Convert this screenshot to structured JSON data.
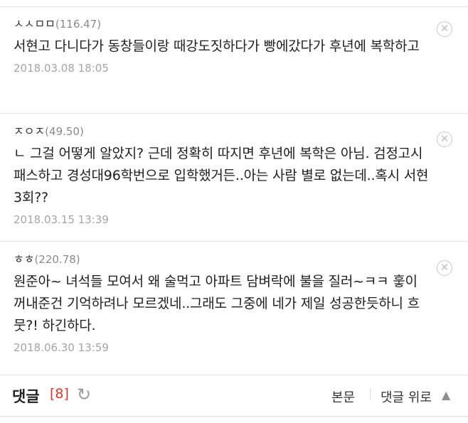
{
  "comments": [
    {
      "author": "ㅅㅅㅁㅁ",
      "score": "(116.47)",
      "text": "서현고 다니다가 동창들이랑 때강도짓하다가 빵에갔다가 후년에 복학하고",
      "date": "2018.03.08 18:05",
      "close_icon": "✕"
    },
    {
      "author": "ㅈㅇㅈ",
      "score": "(49.50)",
      "text": "ㄴ 그걸 어떻게 알았지? 근데 정확히 따지면 후년에 복학은 아님. 검정고시 패스하고 경성대96학번으로 입학했거든..아는 사람 별로 없는데..혹시 서현 3회??",
      "date": "2018.03.15 13:39",
      "close_icon": "✕"
    },
    {
      "author": "ㅎㅎ",
      "score": "(220.78)",
      "text": "원준아~ 녀석들 모여서 왜 술먹고 아파트 담벼락에 불을 질러~ㅋㅋ 훟이 꺼내준건 기억하려나 모르겠네..그래도 그중에 네가 제일 성공한듯하니 흐뭇?! 하긴하다.",
      "date": "2018.06.30 13:59",
      "close_icon": "✕"
    }
  ],
  "footer": {
    "title": "댓글",
    "count": "[8]",
    "refresh_icon": "↻",
    "body_link": "본문",
    "up_link": "댓글 위로",
    "up_icon": "▲"
  },
  "colors": {
    "accent_red": "#e0352b",
    "date_gray": "#a5a5a5"
  }
}
